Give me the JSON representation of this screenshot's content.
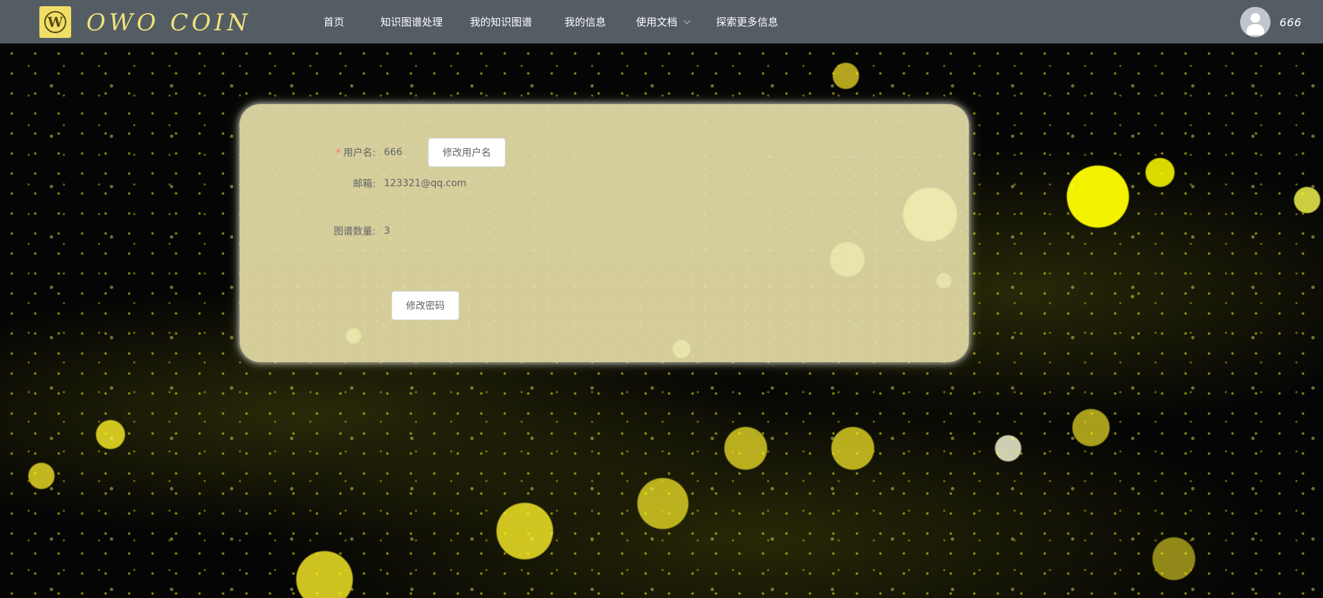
{
  "app": {
    "logo_letter": "W",
    "name": "OWO COIN"
  },
  "nav": {
    "items": [
      {
        "label": "首页"
      },
      {
        "label": "知识图谱处理"
      },
      {
        "label": "我的知识图谱"
      },
      {
        "label": "我的信息"
      },
      {
        "label": "使用文档"
      },
      {
        "label": "探索更多信息"
      }
    ]
  },
  "user": {
    "name": "666",
    "avatar_icon": "user-avatar-icon"
  },
  "profile": {
    "username": {
      "label": "用户名:",
      "required_mark": "*",
      "value": "666",
      "button_label": "修改用户名"
    },
    "email": {
      "label": "邮箱:",
      "value": "123321@qq.com"
    },
    "graph_count": {
      "label": "图谱数量:",
      "value": "3"
    },
    "password_button": {
      "label": "修改密码"
    }
  },
  "colors": {
    "topbar": "#545c64",
    "brand_text": "#f0e27a",
    "card": "#d1ca9a",
    "required": "#f56c6c"
  },
  "icons": {
    "logo": "w-logo-icon",
    "dropdown": "chevron-down-icon"
  }
}
